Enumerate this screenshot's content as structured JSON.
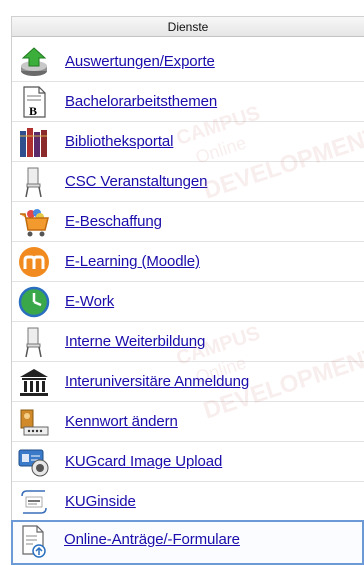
{
  "header": {
    "title": "Dienste"
  },
  "items": [
    {
      "label": "Auswertungen/Exporte",
      "icon": "download-export-icon"
    },
    {
      "label": "Bachelorarbeitsthemen",
      "icon": "document-b-icon"
    },
    {
      "label": "Bibliotheksportal",
      "icon": "books-icon"
    },
    {
      "label": "CSC Veranstaltungen",
      "icon": "chair-icon"
    },
    {
      "label": "E-Beschaffung",
      "icon": "shopping-cart-icon"
    },
    {
      "label": "E-Learning (Moodle)",
      "icon": "moodle-icon"
    },
    {
      "label": "E-Work",
      "icon": "clock-icon"
    },
    {
      "label": "Interne Weiterbildung",
      "icon": "chair-icon"
    },
    {
      "label": "Interuniversitäre Anmeldung",
      "icon": "university-building-icon"
    },
    {
      "label": "Kennwort ändern",
      "icon": "key-password-icon"
    },
    {
      "label": "KUGcard Image Upload",
      "icon": "card-upload-icon"
    },
    {
      "label": "KUGinside",
      "icon": "kuginside-logo-icon"
    },
    {
      "label": "Online-Anträge/-Formulare",
      "icon": "form-upload-icon"
    }
  ],
  "watermark": {
    "line1": "CAMPUS",
    "line2": "Online",
    "line3": "DEVELOPMENT"
  }
}
